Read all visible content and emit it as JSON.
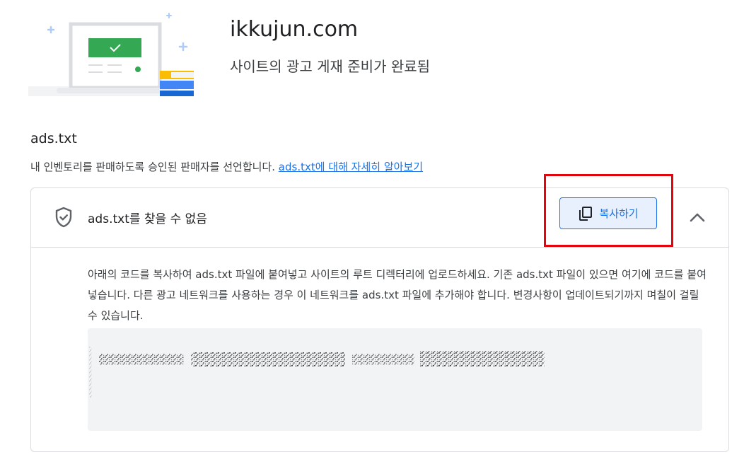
{
  "header": {
    "site_name": "ikkujun.com",
    "status": "사이트의 광고 게재 준비가 완료됨"
  },
  "ads_txt_section": {
    "title": "ads.txt",
    "description": "내 인벤토리를 판매하도록 승인된 판매자를 선언합니다.",
    "learn_more_link": "ads.txt에 대해 자세히 알아보기"
  },
  "panel": {
    "title": "ads.txt를 찾을 수 없음",
    "instructions": "아래의 코드를 복사하여 ads.txt 파일에 붙여넣고 사이트의 루트 디렉터리에 업로드하세요. 기존 ads.txt 파일이 있으면 여기에 코드를 붙여넣습니다. 다른 광고 네트워크를 사용하는 경우 이 네트워크를 ads.txt 파일에 추가해야 합니다. 변경사항이 업데이트되기까지 며칠이 걸릴 수 있습니다.",
    "copy_button_label": "복사하기",
    "icons": {
      "status": "shield-check-icon",
      "collapse": "chevron-up-icon",
      "copy": "copy-icon"
    }
  },
  "colors": {
    "link": "#1a73e8",
    "button_bg": "#e8f0fe",
    "highlight": "#e3050b",
    "code_bg": "#f1f3f4"
  }
}
